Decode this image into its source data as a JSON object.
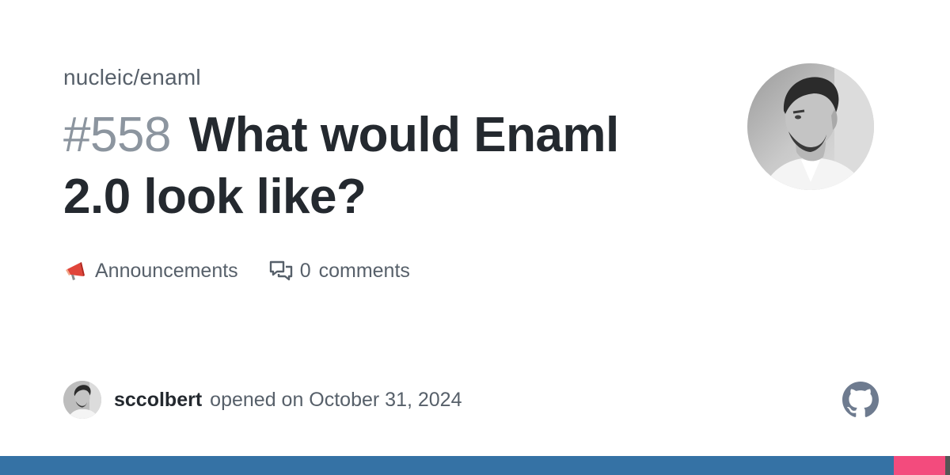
{
  "repo": "nucleic/enaml",
  "issue": {
    "number": "#558",
    "title": "What would Enaml 2.0 look like?"
  },
  "meta": {
    "category_icon": "megaphone-icon",
    "category": "Announcements",
    "comments_icon": "comment-discussion-icon",
    "comment_count": "0",
    "comments_label": "comments"
  },
  "footer": {
    "author": "sccolbert",
    "opened_text": "opened on October 31, 2024"
  },
  "language_bar": [
    {
      "color": "#3572a5",
      "fraction": 0.941
    },
    {
      "color": "#f34b7d",
      "fraction": 0.054
    },
    {
      "color": "#555555",
      "fraction": 0.005
    }
  ],
  "colors": {
    "title": "#24292f",
    "muted": "#57606a",
    "number": "#8c959f"
  }
}
